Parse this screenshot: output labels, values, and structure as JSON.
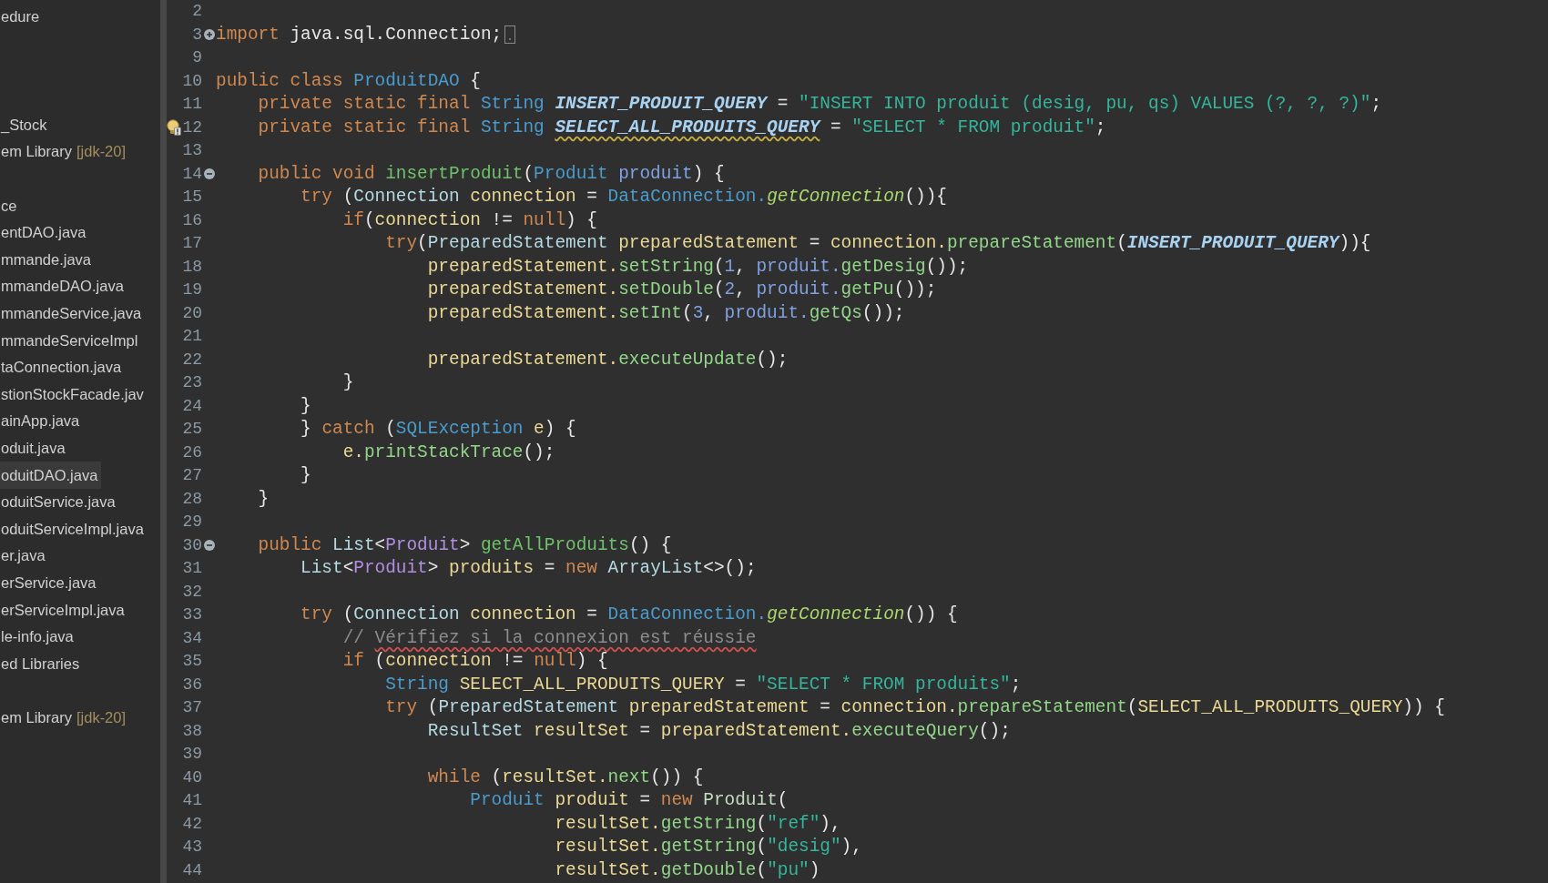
{
  "sidebar": {
    "sections": [
      {
        "items": [
          {
            "label": "edure",
            "selected": false
          }
        ]
      },
      {
        "items": [
          {
            "label": "_Stock",
            "selected": false
          },
          {
            "label": "em Library",
            "detail": "[jdk-20]",
            "selected": false
          }
        ]
      },
      {
        "items": [
          {
            "label": "ce",
            "selected": false
          },
          {
            "label": "entDAO.java",
            "selected": false
          },
          {
            "label": "mmande.java",
            "selected": false
          },
          {
            "label": "mmandeDAO.java",
            "selected": false
          },
          {
            "label": "mmandeService.java",
            "selected": false
          },
          {
            "label": "mmandeServiceImpl",
            "selected": false
          },
          {
            "label": "taConnection.java",
            "selected": false
          },
          {
            "label": "stionStockFacade.jav",
            "selected": false
          },
          {
            "label": "ainApp.java",
            "selected": false
          },
          {
            "label": "oduit.java",
            "selected": false
          },
          {
            "label": "oduitDAO.java",
            "selected": true
          },
          {
            "label": "oduitService.java",
            "selected": false
          },
          {
            "label": "oduitServiceImpl.java",
            "selected": false
          },
          {
            "label": "er.java",
            "selected": false
          },
          {
            "label": "erService.java",
            "selected": false
          },
          {
            "label": "erServiceImpl.java",
            "selected": false
          },
          {
            "label": "le-info.java",
            "selected": false
          },
          {
            "label": "ed Libraries",
            "selected": false
          }
        ]
      },
      {
        "items": [
          {
            "label": "em Library",
            "detail": "[jdk-20]",
            "selected": false
          }
        ]
      }
    ]
  },
  "editor": {
    "lines": [
      {
        "number": "2"
      },
      {
        "number": "3",
        "foldable": true,
        "collapsed": true,
        "tokens": [
          {
            "text": "import",
            "kind": "keyword"
          },
          {
            "text": " java.sql.Connection;",
            "kind": "plain"
          }
        ]
      },
      {
        "number": "9"
      },
      {
        "number": "10",
        "tokens": [
          {
            "text": "public class",
            "kind": "keyword"
          },
          {
            "text": " ProduitDAO",
            "kind": "class"
          },
          {
            "text": " {",
            "kind": "plain"
          }
        ]
      },
      {
        "number": "11",
        "tokens": [
          {
            "text": "    private static final",
            "kind": "keyword"
          },
          {
            "text": " String ",
            "kind": "class"
          },
          {
            "text": "INSERT_PRODUIT_QUERY",
            "kind": "constant"
          },
          {
            "text": " = ",
            "kind": "plain"
          },
          {
            "text": "\"INSERT INTO produit (desig, pu, qs) VALUES (?, ?, ?)\"",
            "kind": "string"
          },
          {
            "text": ";",
            "kind": "plain"
          }
        ]
      },
      {
        "number": "12",
        "warning": true,
        "tokens": [
          {
            "text": "    private static final",
            "kind": "keyword"
          },
          {
            "text": " String ",
            "kind": "class"
          },
          {
            "text": "SELECT_ALL_PRODUITS_QUERY",
            "kind": "constant",
            "warning": true
          },
          {
            "text": " = ",
            "kind": "plain"
          },
          {
            "text": "\"SELECT * FROM produit\"",
            "kind": "string"
          },
          {
            "text": ";",
            "kind": "plain"
          }
        ]
      },
      {
        "number": "13"
      },
      {
        "number": "14",
        "foldable": true,
        "collapsed": false,
        "tokens": [
          {
            "text": "    public void",
            "kind": "keyword"
          },
          {
            "text": " insertProduit",
            "kind": "method_declaration"
          },
          {
            "text": "(",
            "kind": "plain"
          },
          {
            "text": "Produit",
            "kind": "class"
          },
          {
            "text": " produit",
            "kind": "parameter"
          },
          {
            "text": ") {",
            "kind": "plain"
          }
        ]
      },
      {
        "number": "15",
        "tokens": [
          {
            "text": "        try",
            "kind": "keyword"
          },
          {
            "text": " (",
            "kind": "plain"
          },
          {
            "text": "Connection",
            "kind": "interface"
          },
          {
            "text": " connection",
            "kind": "variable"
          },
          {
            "text": " = ",
            "kind": "plain"
          },
          {
            "text": "DataConnection.",
            "kind": "class"
          },
          {
            "text": "getConnection",
            "kind": "static_method"
          },
          {
            "text": "()){",
            "kind": "plain"
          }
        ]
      },
      {
        "number": "16",
        "tokens": [
          {
            "text": "            if",
            "kind": "keyword"
          },
          {
            "text": "(",
            "kind": "plain"
          },
          {
            "text": "connection",
            "kind": "variable"
          },
          {
            "text": " != ",
            "kind": "plain"
          },
          {
            "text": "null",
            "kind": "keyword"
          },
          {
            "text": ") {",
            "kind": "plain"
          }
        ]
      },
      {
        "number": "17",
        "tokens": [
          {
            "text": "                try",
            "kind": "keyword"
          },
          {
            "text": "(",
            "kind": "plain"
          },
          {
            "text": "PreparedStatement",
            "kind": "interface"
          },
          {
            "text": " preparedStatement",
            "kind": "variable"
          },
          {
            "text": " = ",
            "kind": "plain"
          },
          {
            "text": "connection.",
            "kind": "variable"
          },
          {
            "text": "prepareStatement",
            "kind": "method"
          },
          {
            "text": "(",
            "kind": "plain"
          },
          {
            "text": "INSERT_PRODUIT_QUERY",
            "kind": "constant"
          },
          {
            "text": ")){",
            "kind": "plain"
          }
        ]
      },
      {
        "number": "18",
        "tokens": [
          {
            "text": "                    preparedStatement.",
            "kind": "variable"
          },
          {
            "text": "setString",
            "kind": "method"
          },
          {
            "text": "(",
            "kind": "plain"
          },
          {
            "text": "1",
            "kind": "number"
          },
          {
            "text": ", ",
            "kind": "plain"
          },
          {
            "text": "produit.",
            "kind": "parameter"
          },
          {
            "text": "getDesig",
            "kind": "method"
          },
          {
            "text": "());",
            "kind": "plain"
          }
        ]
      },
      {
        "number": "19",
        "tokens": [
          {
            "text": "                    preparedStatement.",
            "kind": "variable"
          },
          {
            "text": "setDouble",
            "kind": "method"
          },
          {
            "text": "(",
            "kind": "plain"
          },
          {
            "text": "2",
            "kind": "number"
          },
          {
            "text": ", ",
            "kind": "plain"
          },
          {
            "text": "produit.",
            "kind": "parameter"
          },
          {
            "text": "getPu",
            "kind": "method"
          },
          {
            "text": "());",
            "kind": "plain"
          }
        ]
      },
      {
        "number": "20",
        "tokens": [
          {
            "text": "                    preparedStatement.",
            "kind": "variable"
          },
          {
            "text": "setInt",
            "kind": "method"
          },
          {
            "text": "(",
            "kind": "plain"
          },
          {
            "text": "3",
            "kind": "number"
          },
          {
            "text": ", ",
            "kind": "plain"
          },
          {
            "text": "produit.",
            "kind": "parameter"
          },
          {
            "text": "getQs",
            "kind": "method"
          },
          {
            "text": "());",
            "kind": "plain"
          }
        ]
      },
      {
        "number": "21"
      },
      {
        "number": "22",
        "tokens": [
          {
            "text": "                    preparedStatement.",
            "kind": "variable"
          },
          {
            "text": "executeUpdate",
            "kind": "method"
          },
          {
            "text": "();",
            "kind": "plain"
          }
        ]
      },
      {
        "number": "23",
        "tokens": [
          {
            "text": "            }",
            "kind": "plain"
          }
        ]
      },
      {
        "number": "24",
        "tokens": [
          {
            "text": "        }",
            "kind": "plain"
          }
        ]
      },
      {
        "number": "25",
        "tokens": [
          {
            "text": "        } ",
            "kind": "plain"
          },
          {
            "text": "catch",
            "kind": "keyword"
          },
          {
            "text": " (",
            "kind": "plain"
          },
          {
            "text": "SQLException",
            "kind": "class"
          },
          {
            "text": " e",
            "kind": "variable"
          },
          {
            "text": ") {",
            "kind": "plain"
          }
        ]
      },
      {
        "number": "26",
        "tokens": [
          {
            "text": "            e.",
            "kind": "variable"
          },
          {
            "text": "printStackTrace",
            "kind": "method"
          },
          {
            "text": "();",
            "kind": "plain"
          }
        ]
      },
      {
        "number": "27",
        "tokens": [
          {
            "text": "        }",
            "kind": "plain"
          }
        ]
      },
      {
        "number": "28",
        "tokens": [
          {
            "text": "    }",
            "kind": "plain"
          }
        ]
      },
      {
        "number": "29"
      },
      {
        "number": "30",
        "foldable": true,
        "collapsed": false,
        "tokens": [
          {
            "text": "    public",
            "kind": "keyword"
          },
          {
            "text": " List",
            "kind": "interface"
          },
          {
            "text": "<",
            "kind": "plain"
          },
          {
            "text": "Produit",
            "kind": "type_argument"
          },
          {
            "text": "> ",
            "kind": "plain"
          },
          {
            "text": "getAllProduits",
            "kind": "method_declaration"
          },
          {
            "text": "() {",
            "kind": "plain"
          }
        ]
      },
      {
        "number": "31",
        "tokens": [
          {
            "text": "        List",
            "kind": "interface"
          },
          {
            "text": "<",
            "kind": "plain"
          },
          {
            "text": "Produit",
            "kind": "type_argument"
          },
          {
            "text": "> ",
            "kind": "plain"
          },
          {
            "text": "produits",
            "kind": "variable"
          },
          {
            "text": " = ",
            "kind": "plain"
          },
          {
            "text": "new",
            "kind": "keyword"
          },
          {
            "text": " ArrayList",
            "kind": "interface"
          },
          {
            "text": "<>();",
            "kind": "plain"
          }
        ]
      },
      {
        "number": "32"
      },
      {
        "number": "33",
        "tokens": [
          {
            "text": "        try",
            "kind": "keyword"
          },
          {
            "text": " (",
            "kind": "plain"
          },
          {
            "text": "Connection",
            "kind": "interface"
          },
          {
            "text": " connection",
            "kind": "variable"
          },
          {
            "text": " = ",
            "kind": "plain"
          },
          {
            "text": "DataConnection.",
            "kind": "class"
          },
          {
            "text": "getConnection",
            "kind": "static_method"
          },
          {
            "text": "()) {",
            "kind": "plain"
          }
        ]
      },
      {
        "number": "34",
        "tokens": [
          {
            "text": "            // ",
            "kind": "comment"
          },
          {
            "text": "Vérifiez si la connexion est réussie",
            "kind": "comment",
            "misspelled": true
          }
        ]
      },
      {
        "number": "35",
        "tokens": [
          {
            "text": "            if",
            "kind": "keyword"
          },
          {
            "text": " (",
            "kind": "plain"
          },
          {
            "text": "connection",
            "kind": "variable"
          },
          {
            "text": " != ",
            "kind": "plain"
          },
          {
            "text": "null",
            "kind": "keyword"
          },
          {
            "text": ") {",
            "kind": "plain"
          }
        ]
      },
      {
        "number": "36",
        "tokens": [
          {
            "text": "                String",
            "kind": "class"
          },
          {
            "text": " SELECT_ALL_PRODUITS_QUERY",
            "kind": "variable"
          },
          {
            "text": " = ",
            "kind": "plain"
          },
          {
            "text": "\"SELECT * FROM produits\"",
            "kind": "string"
          },
          {
            "text": ";",
            "kind": "plain"
          }
        ]
      },
      {
        "number": "37",
        "tokens": [
          {
            "text": "                try",
            "kind": "keyword"
          },
          {
            "text": " (",
            "kind": "plain"
          },
          {
            "text": "PreparedStatement",
            "kind": "interface"
          },
          {
            "text": " preparedStatement",
            "kind": "variable"
          },
          {
            "text": " = ",
            "kind": "plain"
          },
          {
            "text": "connection.",
            "kind": "variable"
          },
          {
            "text": "prepareStatement",
            "kind": "method"
          },
          {
            "text": "(",
            "kind": "plain"
          },
          {
            "text": "SELECT_ALL_PRODUITS_QUERY",
            "kind": "variable"
          },
          {
            "text": ")) {",
            "kind": "plain"
          }
        ]
      },
      {
        "number": "38",
        "tokens": [
          {
            "text": "                    ResultSet",
            "kind": "interface"
          },
          {
            "text": " resultSet",
            "kind": "variable"
          },
          {
            "text": " = ",
            "kind": "plain"
          },
          {
            "text": "preparedStatement.",
            "kind": "variable"
          },
          {
            "text": "executeQuery",
            "kind": "method"
          },
          {
            "text": "();",
            "kind": "plain"
          }
        ]
      },
      {
        "number": "39"
      },
      {
        "number": "40",
        "tokens": [
          {
            "text": "                    while",
            "kind": "keyword"
          },
          {
            "text": " (",
            "kind": "plain"
          },
          {
            "text": "resultSet.",
            "kind": "variable"
          },
          {
            "text": "next",
            "kind": "method"
          },
          {
            "text": "()) {",
            "kind": "plain"
          }
        ]
      },
      {
        "number": "41",
        "tokens": [
          {
            "text": "                        Produit",
            "kind": "class"
          },
          {
            "text": " produit",
            "kind": "variable"
          },
          {
            "text": " = ",
            "kind": "plain"
          },
          {
            "text": "new",
            "kind": "keyword"
          },
          {
            "text": " Produit",
            "kind": "constructor"
          },
          {
            "text": "(",
            "kind": "plain"
          }
        ]
      },
      {
        "number": "42",
        "tokens": [
          {
            "text": "                                resultSet.",
            "kind": "variable"
          },
          {
            "text": "getString",
            "kind": "method"
          },
          {
            "text": "(",
            "kind": "plain"
          },
          {
            "text": "\"ref\"",
            "kind": "string"
          },
          {
            "text": "),",
            "kind": "plain"
          }
        ]
      },
      {
        "number": "43",
        "tokens": [
          {
            "text": "                                resultSet.",
            "kind": "variable"
          },
          {
            "text": "getString",
            "kind": "method"
          },
          {
            "text": "(",
            "kind": "plain"
          },
          {
            "text": "\"desig\"",
            "kind": "string"
          },
          {
            "text": "),",
            "kind": "plain"
          }
        ]
      },
      {
        "number": "44",
        "tokens": [
          {
            "text": "                                resultSet.",
            "kind": "variable"
          },
          {
            "text": "getDouble",
            "kind": "method"
          },
          {
            "text": "(",
            "kind": "plain"
          },
          {
            "text": "\"pu\"",
            "kind": "string"
          },
          {
            "text": ")",
            "kind": "plain"
          }
        ]
      }
    ]
  }
}
